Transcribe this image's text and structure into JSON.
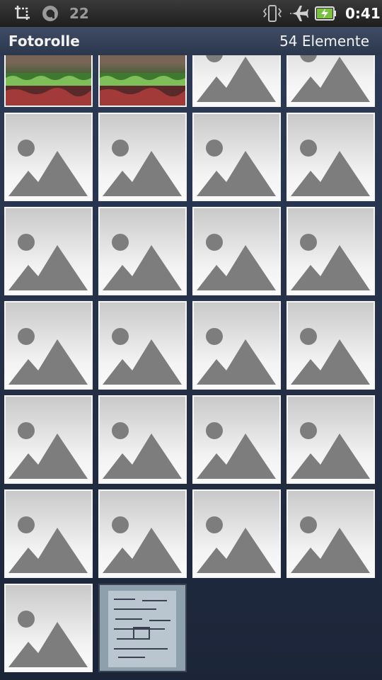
{
  "status_bar": {
    "notification_count": "22",
    "time": "0:41",
    "icons": [
      "crop-icon",
      "circle-a-icon",
      "vibrate-icon",
      "airplane-icon",
      "battery-charging-icon"
    ]
  },
  "title_bar": {
    "title": "Fotorolle",
    "item_count": "54 Elemente"
  },
  "gallery": {
    "tiles": [
      {
        "type": "video"
      },
      {
        "type": "video"
      },
      {
        "type": "placeholder"
      },
      {
        "type": "placeholder"
      },
      {
        "type": "placeholder"
      },
      {
        "type": "placeholder"
      },
      {
        "type": "placeholder"
      },
      {
        "type": "placeholder"
      },
      {
        "type": "placeholder"
      },
      {
        "type": "placeholder"
      },
      {
        "type": "placeholder"
      },
      {
        "type": "placeholder"
      },
      {
        "type": "placeholder"
      },
      {
        "type": "placeholder"
      },
      {
        "type": "placeholder"
      },
      {
        "type": "placeholder"
      },
      {
        "type": "placeholder"
      },
      {
        "type": "placeholder"
      },
      {
        "type": "placeholder"
      },
      {
        "type": "placeholder"
      },
      {
        "type": "placeholder"
      },
      {
        "type": "placeholder"
      },
      {
        "type": "placeholder"
      },
      {
        "type": "placeholder"
      },
      {
        "type": "placeholder"
      },
      {
        "type": "document"
      }
    ]
  }
}
